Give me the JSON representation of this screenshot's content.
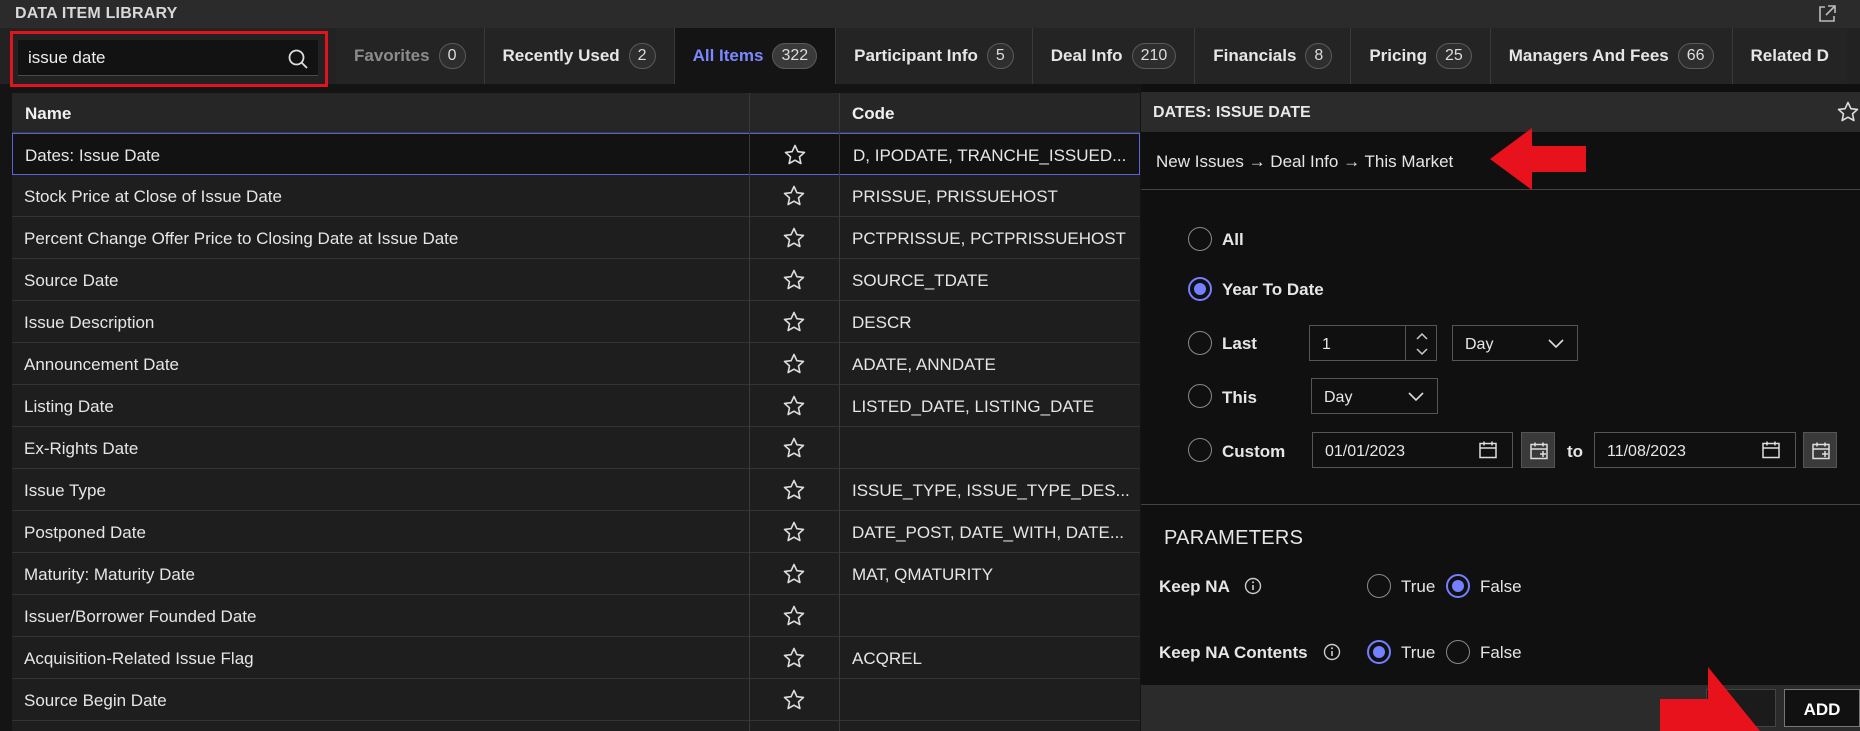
{
  "window": {
    "title": "DATA ITEM LIBRARY"
  },
  "search": {
    "value": "issue date"
  },
  "tabs": [
    {
      "label": "Favorites",
      "count": "0"
    },
    {
      "label": "Recently Used",
      "count": "2"
    },
    {
      "label": "All Items",
      "count": "322"
    },
    {
      "label": "Participant Info",
      "count": "5"
    },
    {
      "label": "Deal Info",
      "count": "210"
    },
    {
      "label": "Financials",
      "count": "8"
    },
    {
      "label": "Pricing",
      "count": "25"
    },
    {
      "label": "Managers And Fees",
      "count": "66"
    },
    {
      "label": "Related D",
      "count": ""
    }
  ],
  "table": {
    "headers": {
      "name": "Name",
      "code": "Code"
    },
    "rows": [
      {
        "name": "Dates: Issue Date",
        "code": "D, IPODATE, TRANCHE_ISSUED..."
      },
      {
        "name": "Stock Price at Close of Issue Date",
        "code": "PRISSUE, PRISSUEHOST"
      },
      {
        "name": "Percent Change Offer Price to Closing Date at Issue Date",
        "code": "PCTPRISSUE, PCTPRISSUEHOST"
      },
      {
        "name": "Source Date",
        "code": "SOURCE_TDATE"
      },
      {
        "name": "Issue Description",
        "code": "DESCR"
      },
      {
        "name": "Announcement Date",
        "code": "ADATE, ANNDATE"
      },
      {
        "name": "Listing Date",
        "code": "LISTED_DATE, LISTING_DATE"
      },
      {
        "name": "Ex-Rights Date",
        "code": ""
      },
      {
        "name": "Issue Type",
        "code": "ISSUE_TYPE, ISSUE_TYPE_DES..."
      },
      {
        "name": "Postponed Date",
        "code": "DATE_POST, DATE_WITH, DATE..."
      },
      {
        "name": "Maturity: Maturity Date",
        "code": "MAT, QMATURITY"
      },
      {
        "name": "Issuer/Borrower Founded Date",
        "code": ""
      },
      {
        "name": "Acquisition-Related Issue Flag",
        "code": "ACQREL"
      },
      {
        "name": "Source Begin Date",
        "code": ""
      }
    ]
  },
  "detail": {
    "title": "DATES: ISSUE DATE",
    "breadcrumb": "New Issues → Deal Info → This Market",
    "options": {
      "all": "All",
      "ytd": "Year To Date",
      "last": "Last",
      "this": "This",
      "custom": "Custom"
    },
    "selected_option": "Year To Date",
    "last_value": "1",
    "last_unit": "Day",
    "this_unit": "Day",
    "custom_from": "01/01/2023",
    "custom_to_label": "to",
    "custom_to": "11/08/2023",
    "parameters_title": "PARAMETERS",
    "keep_na": {
      "label": "Keep NA",
      "true": "True",
      "false": "False",
      "selected": "False"
    },
    "keep_na_contents": {
      "label": "Keep NA Contents",
      "true": "True",
      "false": "False",
      "selected": "True"
    },
    "add_label": "ADD"
  },
  "colors": {
    "accent": "#7380ff",
    "highlight": "#e0141e",
    "selected_tab": "#7b88ff"
  }
}
